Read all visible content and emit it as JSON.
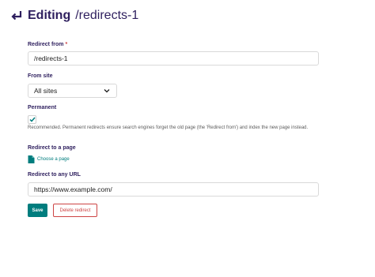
{
  "header": {
    "title_action": "Editing",
    "title_subject": "/redirects-1",
    "back_icon": "back-arrow-icon"
  },
  "form": {
    "redirect_from": {
      "label": "Redirect from",
      "required_mark": "*",
      "value": "/redirects-1"
    },
    "from_site": {
      "label": "From site",
      "selected": "All sites"
    },
    "permanent": {
      "label": "Permanent",
      "checked": true,
      "help": "Recommended. Permanent redirects ensure search engines forget the old page (the 'Redirect from') and index the new page instead."
    },
    "redirect_to_page": {
      "label": "Redirect to a page",
      "choose_label": "Choose a page"
    },
    "redirect_to_url": {
      "label": "Redirect to any URL",
      "value": "https://www.example.com/"
    }
  },
  "actions": {
    "save_label": "Save",
    "delete_label": "Delete redirect"
  },
  "colors": {
    "accent": "#007d7e",
    "danger": "#cd4444",
    "heading": "#2e1f5e"
  }
}
